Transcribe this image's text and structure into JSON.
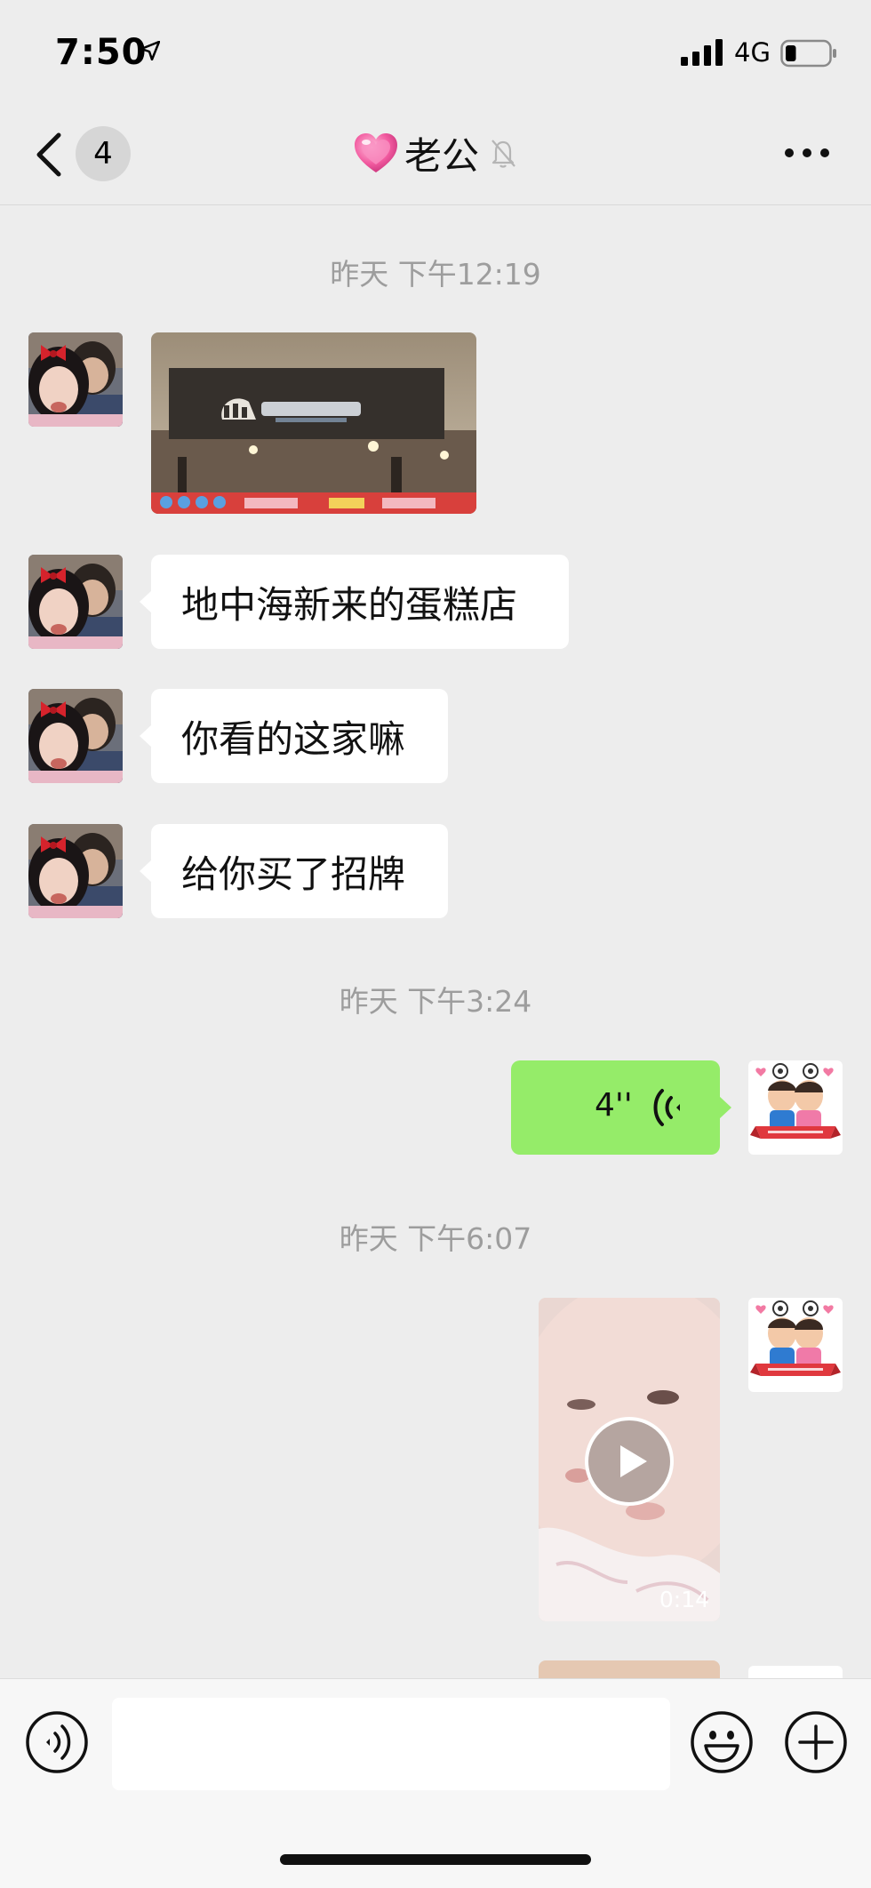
{
  "status_bar": {
    "time": "7:50",
    "network": "4G",
    "battery_level": 0.25
  },
  "nav": {
    "unread_count": "4",
    "title": "老公",
    "muted": true
  },
  "messages": [
    {
      "timestamp": "昨天 下午12:19"
    },
    {
      "text": "地中海新来的蛋糕店"
    },
    {
      "text": "你看的这家嘛"
    },
    {
      "text": "给你买了招牌"
    },
    {
      "timestamp": "昨天 下午3:24"
    },
    {
      "voice_duration": "4''"
    },
    {
      "timestamp": "昨天 下午6:07"
    },
    {
      "video_duration": "0:14"
    }
  ],
  "colors": {
    "outgoing_bubble": "#95ec69",
    "incoming_bubble": "#ffffff",
    "background": "#ededed"
  }
}
